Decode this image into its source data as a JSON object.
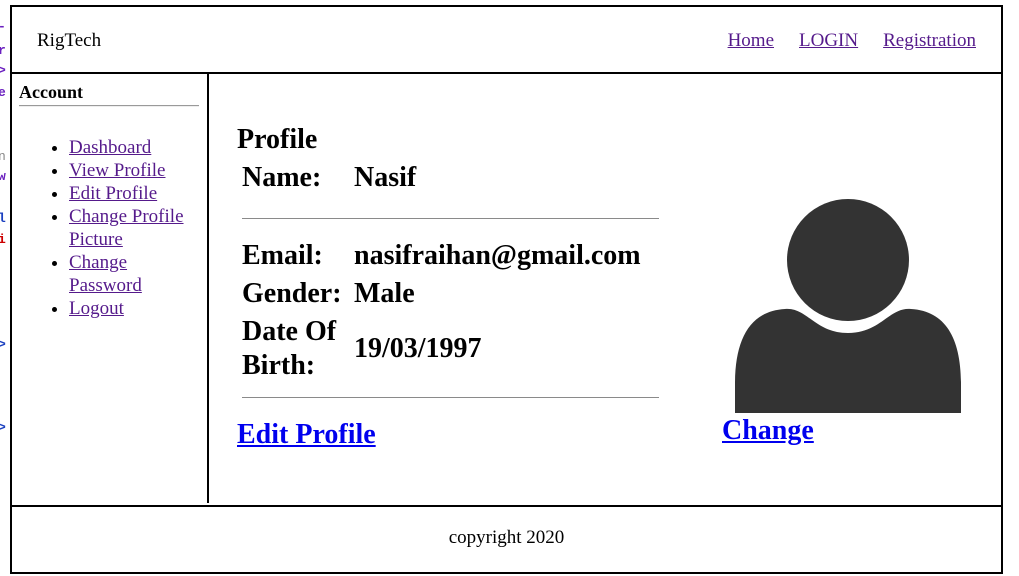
{
  "header": {
    "brand": "RigTech",
    "nav": [
      "Home",
      "LOGIN",
      "Registration"
    ]
  },
  "sidebar": {
    "title": "Account",
    "items": [
      "Dashboard",
      "View Profile",
      "Edit Profile",
      "Change Profile Picture",
      "Change Password",
      "Logout"
    ]
  },
  "profile": {
    "title": "Profile",
    "name_label": "Name:",
    "name_value": "Nasif",
    "email_label": "Email:",
    "email_value": "nasifraihan@gmail.com",
    "gender_label": "Gender:",
    "gender_value": "Male",
    "dob_label": "Date Of Birth:",
    "dob_value": "19/03/1997",
    "edit_link": "Edit Profile",
    "change_link": "Change",
    "avatar_icon": "user-silhouette-icon"
  },
  "footer": {
    "copyright": "copyright 2020"
  },
  "colors": {
    "visited_link": "#551a8b",
    "link": "#0000ee",
    "avatar": "#333333"
  }
}
